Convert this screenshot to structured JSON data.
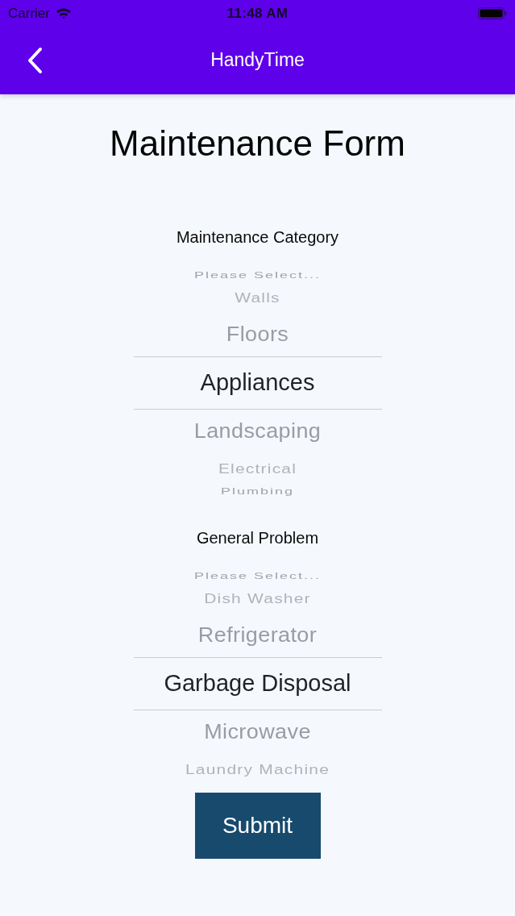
{
  "status_bar": {
    "carrier": "Carrier",
    "time": "11:48 AM"
  },
  "nav_bar": {
    "title": "HandyTime"
  },
  "title": "Maintenance Form",
  "pickers": [
    {
      "label": "Maintenance Category",
      "options": [
        {
          "label": "Please Select...",
          "selected": false
        },
        {
          "label": "Walls",
          "selected": false
        },
        {
          "label": "Floors",
          "selected": false
        },
        {
          "label": "Appliances",
          "selected": true
        },
        {
          "label": "Landscaping",
          "selected": false
        },
        {
          "label": "Electrical",
          "selected": false
        },
        {
          "label": "Plumbing",
          "selected": false
        }
      ]
    },
    {
      "label": "General Problem",
      "options": [
        {
          "label": "Please Select...",
          "selected": false
        },
        {
          "label": "Dish Washer",
          "selected": false
        },
        {
          "label": "Refrigerator",
          "selected": false
        },
        {
          "label": "Garbage Disposal",
          "selected": true
        },
        {
          "label": "Microwave",
          "selected": false
        },
        {
          "label": "Laundry Machine",
          "selected": false
        }
      ]
    }
  ],
  "submit": {
    "label": "Submit"
  }
}
